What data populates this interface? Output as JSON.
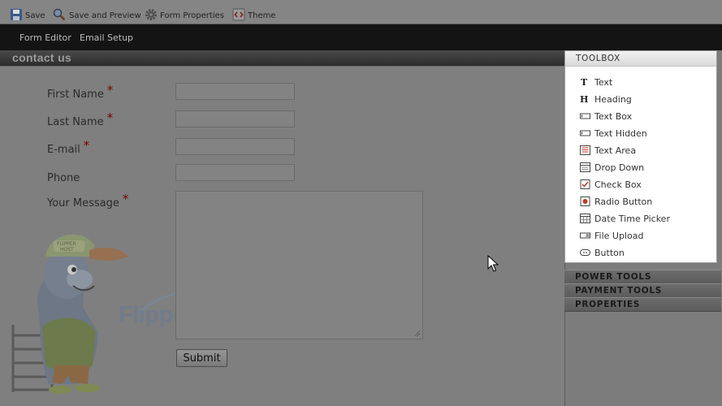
{
  "toolbar": {
    "save_label": "Save",
    "save_preview_label": "Save and Preview",
    "form_properties_label": "Form Properties",
    "theme_label": "Theme"
  },
  "nav": {
    "form_editor_label": "Form Editor",
    "email_setup_label": "Email Setup"
  },
  "form": {
    "title": "contact us",
    "fields": [
      {
        "label": "First Name",
        "required": "*",
        "value": ""
      },
      {
        "label": "Last Name",
        "required": "*",
        "value": ""
      },
      {
        "label": "E-mail",
        "required": "*",
        "value": ""
      },
      {
        "label": "Phone",
        "required": "",
        "value": ""
      },
      {
        "label": "Your Message",
        "required": "*",
        "value": ""
      }
    ],
    "submit_label": "Submit"
  },
  "watermark": {
    "text": "FlipperHost",
    "cap_text": "FLIPPER HOST"
  },
  "toolbox": {
    "title": "TOOLBOX",
    "items": [
      {
        "label": "Text",
        "icon": "text-icon"
      },
      {
        "label": "Heading",
        "icon": "heading-icon"
      },
      {
        "label": "Text Box",
        "icon": "textbox-icon"
      },
      {
        "label": "Text Hidden",
        "icon": "text-hidden-icon"
      },
      {
        "label": "Text Area",
        "icon": "textarea-icon"
      },
      {
        "label": "Drop Down",
        "icon": "dropdown-icon"
      },
      {
        "label": "Check Box",
        "icon": "checkbox-icon"
      },
      {
        "label": "Radio Button",
        "icon": "radio-button-icon"
      },
      {
        "label": "Date Time Picker",
        "icon": "date-time-picker-icon"
      },
      {
        "label": "File Upload",
        "icon": "file-upload-icon"
      },
      {
        "label": "Button",
        "icon": "button-icon"
      }
    ]
  },
  "sections": {
    "power_tools": "POWER TOOLS",
    "payment_tools": "PAYMENT TOOLS",
    "properties": "PROPERTIES"
  },
  "colors": {
    "required_star": "#7a0000",
    "nav_background": "#141414",
    "overlay_gray": "#7f7f7f"
  }
}
